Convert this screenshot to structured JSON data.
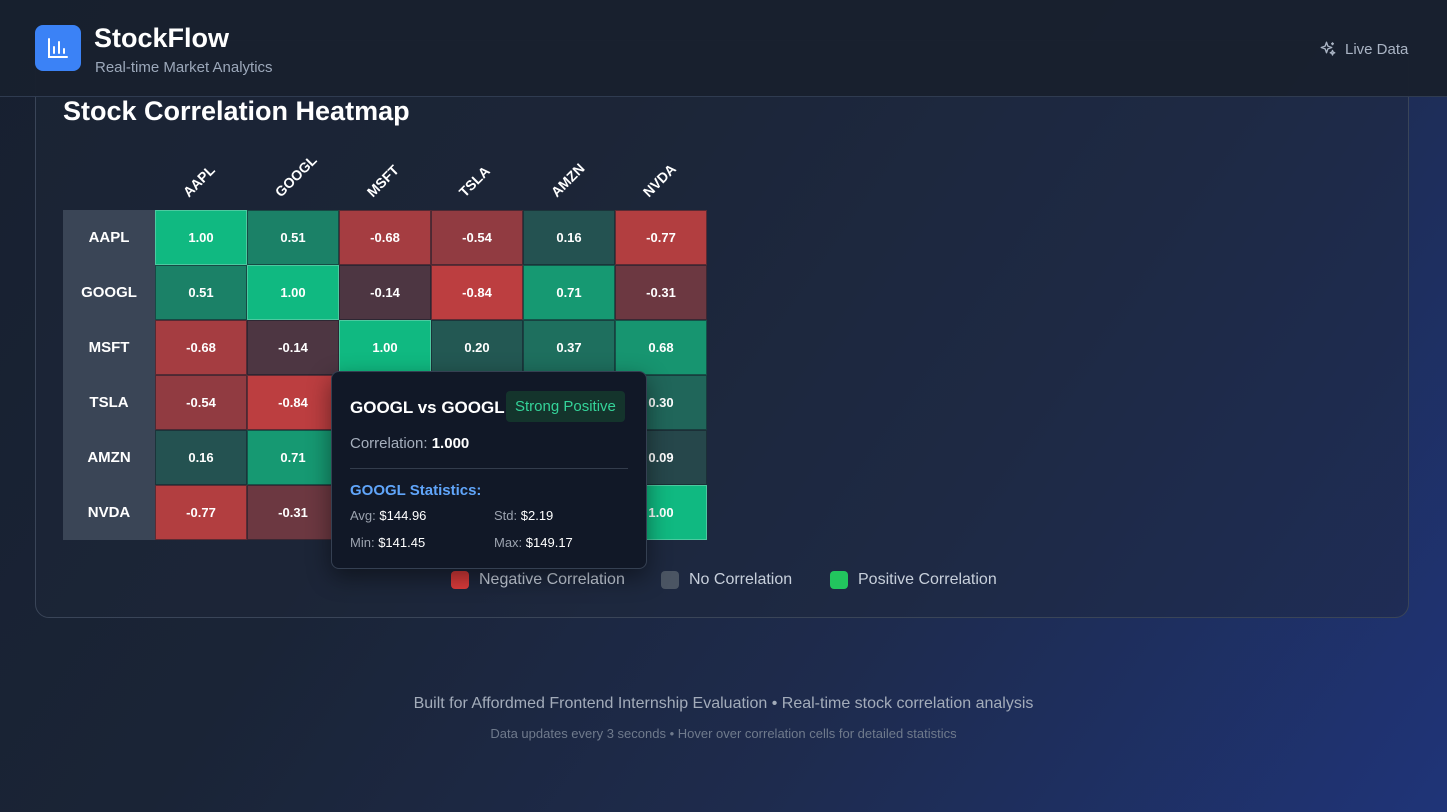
{
  "header": {
    "brand": "StockFlow",
    "subtitle": "Real-time Market Analytics",
    "logo_icon": "bar-chart-icon",
    "live_icon": "sparkles-icon",
    "live_label": "Live Data"
  },
  "heatmap": {
    "title": "Stock Correlation Heatmap",
    "tickers": [
      "AAPL",
      "GOOGL",
      "MSFT",
      "TSLA",
      "AMZN",
      "NVDA"
    ],
    "matrix": [
      [
        "1.00",
        "0.51",
        "-0.68",
        "-0.54",
        "0.16",
        "-0.77"
      ],
      [
        "0.51",
        "1.00",
        "-0.14",
        "-0.84",
        "0.71",
        "-0.31"
      ],
      [
        "-0.68",
        "-0.14",
        "1.00",
        "0.20",
        "0.37",
        "0.68"
      ],
      [
        "-0.54",
        "-0.84",
        "",
        "",
        "",
        "0.30"
      ],
      [
        "0.16",
        "0.71",
        "",
        "",
        "",
        "0.09"
      ],
      [
        "-0.77",
        "-0.31",
        "",
        "",
        "",
        "1.00"
      ]
    ],
    "colors": {
      "strong_positive": "#10b981",
      "negative": "#c53f3f",
      "neutral": "#2a3342"
    }
  },
  "tooltip": {
    "title": "GOOGL vs GOOGL",
    "badge": "Strong Positive",
    "correlation_label": "Correlation:",
    "correlation_value": "1.000",
    "stats_title": "GOOGL Statistics:",
    "avg_label": "Avg:",
    "avg_value": "$144.96",
    "std_label": "Std:",
    "std_value": "$2.19",
    "min_label": "Min:",
    "min_value": "$141.45",
    "max_label": "Max:",
    "max_value": "$149.17"
  },
  "legend": {
    "negative": {
      "label": "Negative Correlation",
      "color": "#dc3b3b"
    },
    "none": {
      "label": "No Correlation",
      "color": "#4b5563"
    },
    "positive": {
      "label": "Positive Correlation",
      "color": "#22c55e"
    }
  },
  "footer": {
    "line1": "Built for Affordmed Frontend Internship Evaluation • Real-time stock correlation analysis",
    "line2": "Data updates every 3 seconds • Hover over correlation cells for detailed statistics"
  }
}
